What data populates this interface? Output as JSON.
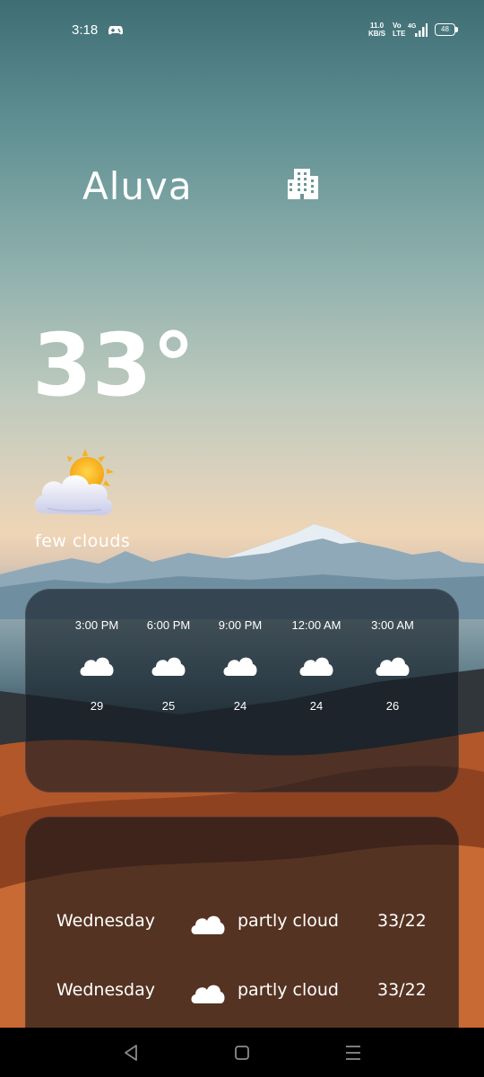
{
  "status_bar": {
    "time": "3:18",
    "net_speed_value": "11.0",
    "net_speed_unit": "KB/S",
    "volte_top": "Vo",
    "volte_bottom": "LTE",
    "network": "4G",
    "battery": "48",
    "icons": [
      "game-controller-icon",
      "volte-icon",
      "signal-icon",
      "battery-icon"
    ]
  },
  "header": {
    "city": "Aluva",
    "icon": "building-icon"
  },
  "current": {
    "temperature": "33°",
    "condition": "few clouds",
    "icon": "sun-behind-cloud-icon"
  },
  "hourly": [
    {
      "time": "3:00 PM",
      "temp": "29",
      "icon": "cloud-icon"
    },
    {
      "time": "6:00 PM",
      "temp": "25",
      "icon": "cloud-icon"
    },
    {
      "time": "9:00 PM",
      "temp": "24",
      "icon": "cloud-icon"
    },
    {
      "time": "12:00 AM",
      "temp": "24",
      "icon": "cloud-icon"
    },
    {
      "time": "3:00 AM",
      "temp": "26",
      "icon": "cloud-icon"
    }
  ],
  "daily": [
    {
      "day": "Wednesday",
      "desc": "partly cloud",
      "temp": "33/22",
      "icon": "cloud-icon"
    },
    {
      "day": "Wednesday",
      "desc": "partly cloud",
      "temp": "33/22",
      "icon": "cloud-icon"
    }
  ],
  "nav": [
    "back-icon",
    "home-icon",
    "menu-icon"
  ],
  "colors": {
    "text": "#ffffff",
    "panel": "#121a22",
    "sky_top": "#3e6e74",
    "horizon": "#efd5b6",
    "dune": "#c0652f"
  }
}
